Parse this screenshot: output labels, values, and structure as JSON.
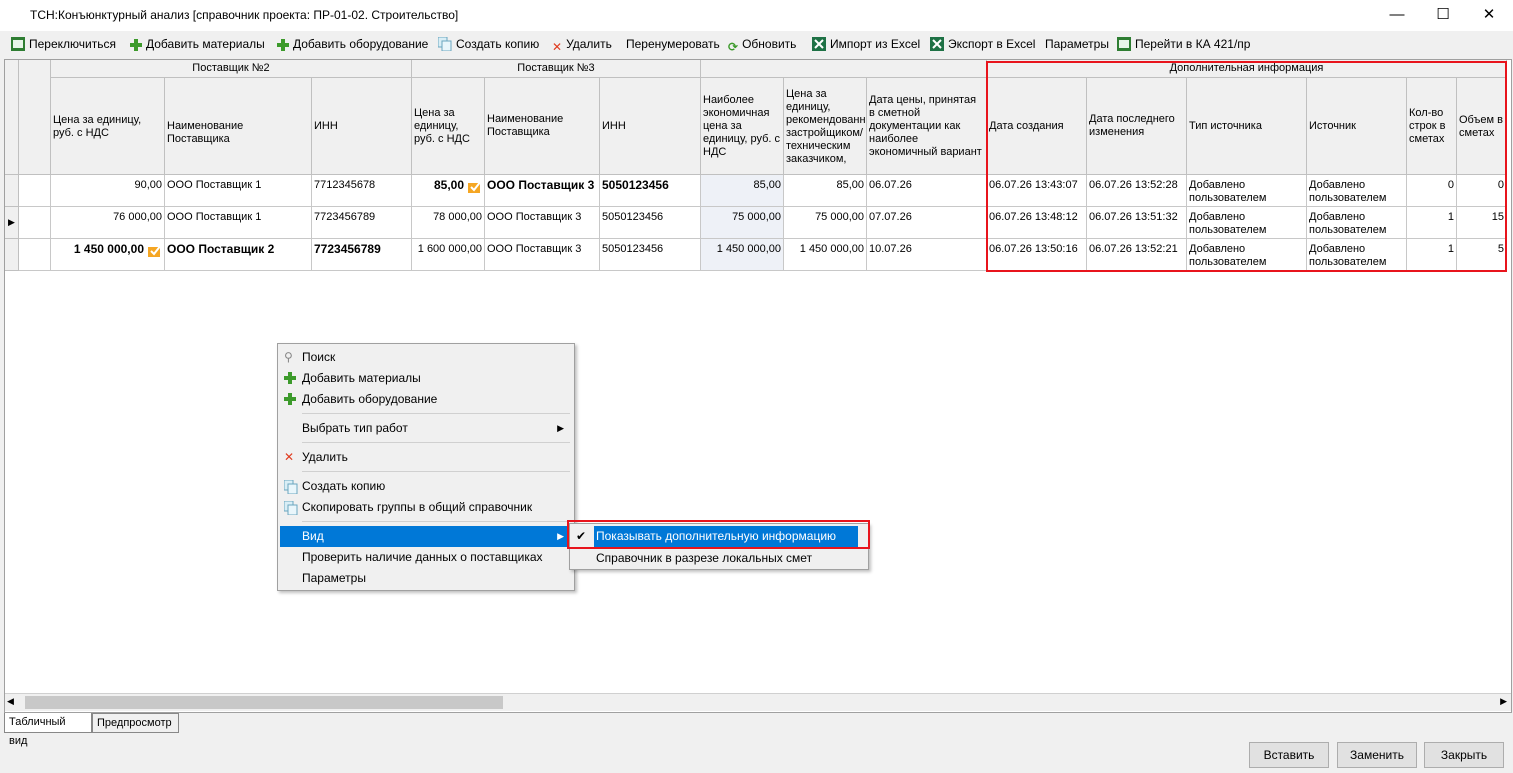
{
  "window": {
    "title": "ТСН:Конъюнктурный анализ [справочник проекта: ПР-01-02. Строительство]"
  },
  "toolbar": {
    "switch": "Переключиться",
    "add_materials": "Добавить материалы",
    "add_equipment": "Добавить оборудование",
    "create_copy": "Создать копию",
    "delete": "Удалить",
    "renumber": "Перенумеровать",
    "refresh": "Обновить",
    "import_excel": "Импорт из Excel",
    "export_excel": "Экспорт в Excel",
    "params": "Параметры",
    "goto_ka": "Перейти в КА 421/пр"
  },
  "grid": {
    "groups": {
      "supplier2": "Поставщик №2",
      "supplier3": "Поставщик №3",
      "extra": "Дополнительная информация"
    },
    "columns": {
      "price2": "Цена за единицу, руб. с НДС",
      "name2": "Наименование Поставщика",
      "inn2": "ИНН",
      "price3": "Цена за единицу, руб. с НДС",
      "name3": "Наименование Поставщика",
      "inn3": "ИНН",
      "econ_price": "Наиболее экономичная цена за единицу, руб. с НДС",
      "recommended": "Цена за единицу, рекомендованная застройщиком/ техническим заказчиком,",
      "price_date": "Дата цены, принятая в сметной документации как наиболее экономичный вариант",
      "created": "Дата создания",
      "modified": "Дата последнего изменения",
      "source_type": "Тип источника",
      "source": "Источник",
      "rows_count": "Кол-во строк в сметах",
      "volume": "Объем в сметах"
    },
    "rows": [
      {
        "price2": "90,00",
        "name2": "ООО Поставщик 1",
        "inn2": "7712345678",
        "price3": "85,00",
        "name3": "ООО Поставщик 3",
        "inn3": "5050123456",
        "econ": "85,00",
        "recommended": "85,00",
        "date": "06.07.26",
        "created": "06.07.26 13:43:07",
        "modified": "06.07.26 13:52:28",
        "source_type": "Добавлено пользователем",
        "source": "Добавлено пользователем",
        "rows_count": "0",
        "volume": "0"
      },
      {
        "price2": "76 000,00",
        "name2": "ООО Поставщик 1",
        "inn2": "7723456789",
        "price3": "78 000,00",
        "name3": "ООО Поставщик 3",
        "inn3": "5050123456",
        "econ": "75 000,00",
        "recommended": "75 000,00",
        "date": "07.07.26",
        "created": "06.07.26 13:48:12",
        "modified": "06.07.26 13:51:32",
        "source_type": "Добавлено пользователем",
        "source": "Добавлено пользователем",
        "rows_count": "1",
        "volume": "15"
      },
      {
        "price2": "1 450 000,00",
        "name2": "ООО Поставщик 2",
        "inn2": "7723456789",
        "price3": "1 600 000,00",
        "name3": "ООО Поставщик 3",
        "inn3": "5050123456",
        "econ": "1 450 000,00",
        "recommended": "1 450 000,00",
        "date": "10.07.26",
        "created": "06.07.26 13:50:16",
        "modified": "06.07.26 13:52:21",
        "source_type": "Добавлено пользователем",
        "source": "Добавлено пользователем",
        "rows_count": "1",
        "volume": "5"
      }
    ]
  },
  "context_menu": {
    "search": "Поиск",
    "add_materials": "Добавить материалы",
    "add_equipment": "Добавить оборудование",
    "select_work_type": "Выбрать тип работ",
    "delete": "Удалить",
    "create_copy": "Создать копию",
    "copy_groups": "Скопировать группы в общий справочник",
    "view": "Вид",
    "check_suppliers": "Проверить наличие данных о поставщиках",
    "params": "Параметры"
  },
  "submenu": {
    "show_extra": "Показывать дополнительную информацию",
    "by_local": "Справочник в разрезе локальных смет"
  },
  "tabs": {
    "table": "Табличный вид",
    "preview": "Предпросмотр"
  },
  "buttons": {
    "insert": "Вставить",
    "replace": "Заменить",
    "close": "Закрыть"
  },
  "colors": {
    "highlight": "#e8141c",
    "selection": "#0078d7"
  }
}
